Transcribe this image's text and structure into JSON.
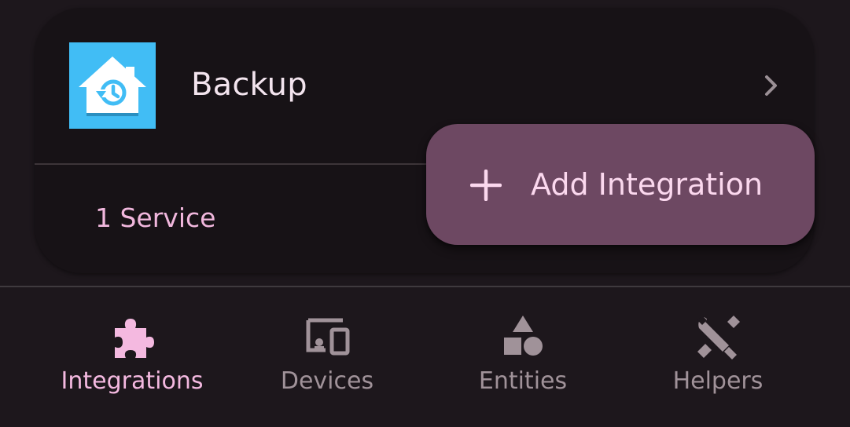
{
  "card": {
    "title": "Backup",
    "services_link": "1 Service",
    "brand_icon": "home-backup-icon",
    "chevron_icon": "chevron-right-icon"
  },
  "fab": {
    "label": "Add Integration",
    "icon": "plus-icon"
  },
  "bottom_nav": {
    "items": [
      {
        "label": "Integrations",
        "icon": "puzzle-icon",
        "active": true
      },
      {
        "label": "Devices",
        "icon": "devices-icon",
        "active": false
      },
      {
        "label": "Entities",
        "icon": "shapes-icon",
        "active": false
      },
      {
        "label": "Helpers",
        "icon": "tools-icon",
        "active": false
      }
    ]
  },
  "colors": {
    "background": "#1d171c",
    "card": "#171216",
    "accent": "#f1b7dd",
    "fab": "#6d4862",
    "brand": "#41bdf5",
    "inactive": "#a09299"
  }
}
